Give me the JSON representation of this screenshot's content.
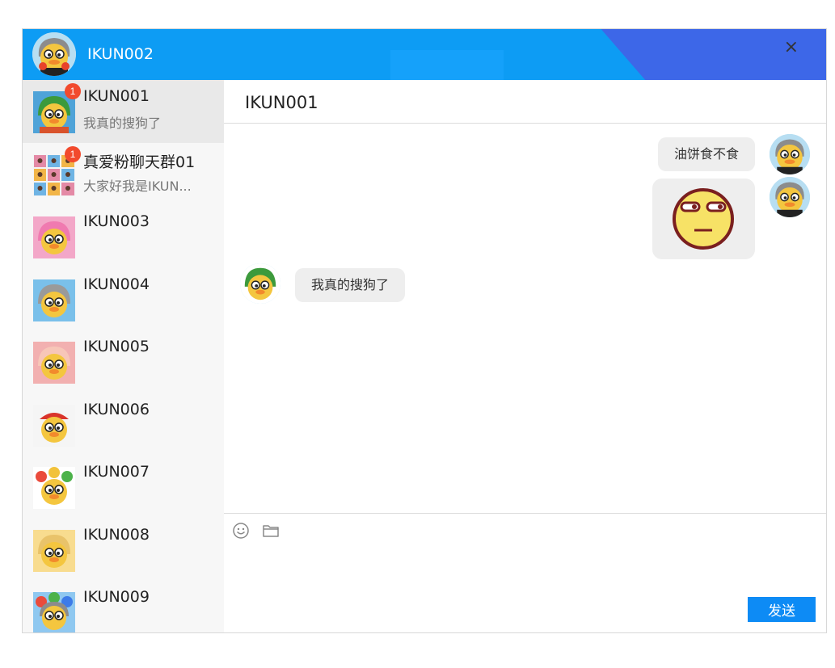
{
  "header": {
    "user_name": "IKUN002",
    "close_label": "×"
  },
  "contacts": [
    {
      "name": "IKUN001",
      "preview": "我真的搜狗了",
      "badge": "1",
      "active": true,
      "color": "#4fa3d8"
    },
    {
      "name": "真爱粉聊天群01",
      "preview": "大家好我是IKUN...",
      "badge": "1",
      "group": true
    },
    {
      "name": "IKUN003",
      "preview": "",
      "color": "#f3a7c8"
    },
    {
      "name": "IKUN004",
      "preview": "",
      "color": "#7ac0ea"
    },
    {
      "name": "IKUN005",
      "preview": "",
      "color": "#f2b0b0"
    },
    {
      "name": "IKUN006",
      "preview": "",
      "color": "#f5d3a0"
    },
    {
      "name": "IKUN007",
      "preview": "",
      "color": "#fbe6a8"
    },
    {
      "name": "IKUN008",
      "preview": "",
      "color": "#f8dc8f"
    },
    {
      "name": "IKUN009",
      "preview": "",
      "color": "#8fc8f0"
    }
  ],
  "chat": {
    "title": "IKUN001",
    "messages": [
      {
        "from": "me",
        "type": "text",
        "text": "油饼食不食"
      },
      {
        "from": "me",
        "type": "emoji",
        "emoji": "unamused-face"
      },
      {
        "from": "other",
        "type": "text",
        "text": "我真的搜狗了"
      }
    ]
  },
  "composer": {
    "emoji_icon": "smile-icon",
    "file_icon": "folder-icon",
    "send_label": "发送"
  }
}
